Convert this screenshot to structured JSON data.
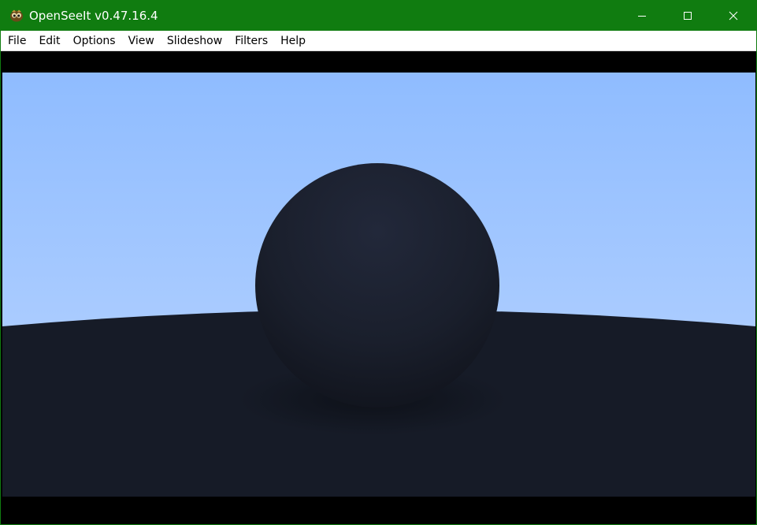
{
  "window": {
    "title": "OpenSeeIt v0.47.16.4",
    "title_bar_color": "#107c10",
    "app_icon": "openseeit-app-icon"
  },
  "menu": {
    "items": [
      {
        "id": "file",
        "label": "File"
      },
      {
        "id": "edit",
        "label": "Edit"
      },
      {
        "id": "options",
        "label": "Options"
      },
      {
        "id": "view",
        "label": "View"
      },
      {
        "id": "slideshow",
        "label": "Slideshow"
      },
      {
        "id": "filters",
        "label": "Filters"
      },
      {
        "id": "help",
        "label": "Help"
      }
    ]
  },
  "controls": {
    "minimize_icon": "minimize-icon",
    "maximize_icon": "maximize-icon",
    "close_icon": "close-icon"
  },
  "image": {
    "subject": "rendered dark sphere on dark ground under blue sky",
    "sky_color_top": "#8fbcff",
    "sky_color_bottom": "#bcd6ff",
    "ground_color": "#161b27",
    "sphere_color": "#1a1f2c",
    "letterbox_color": "#000000"
  }
}
